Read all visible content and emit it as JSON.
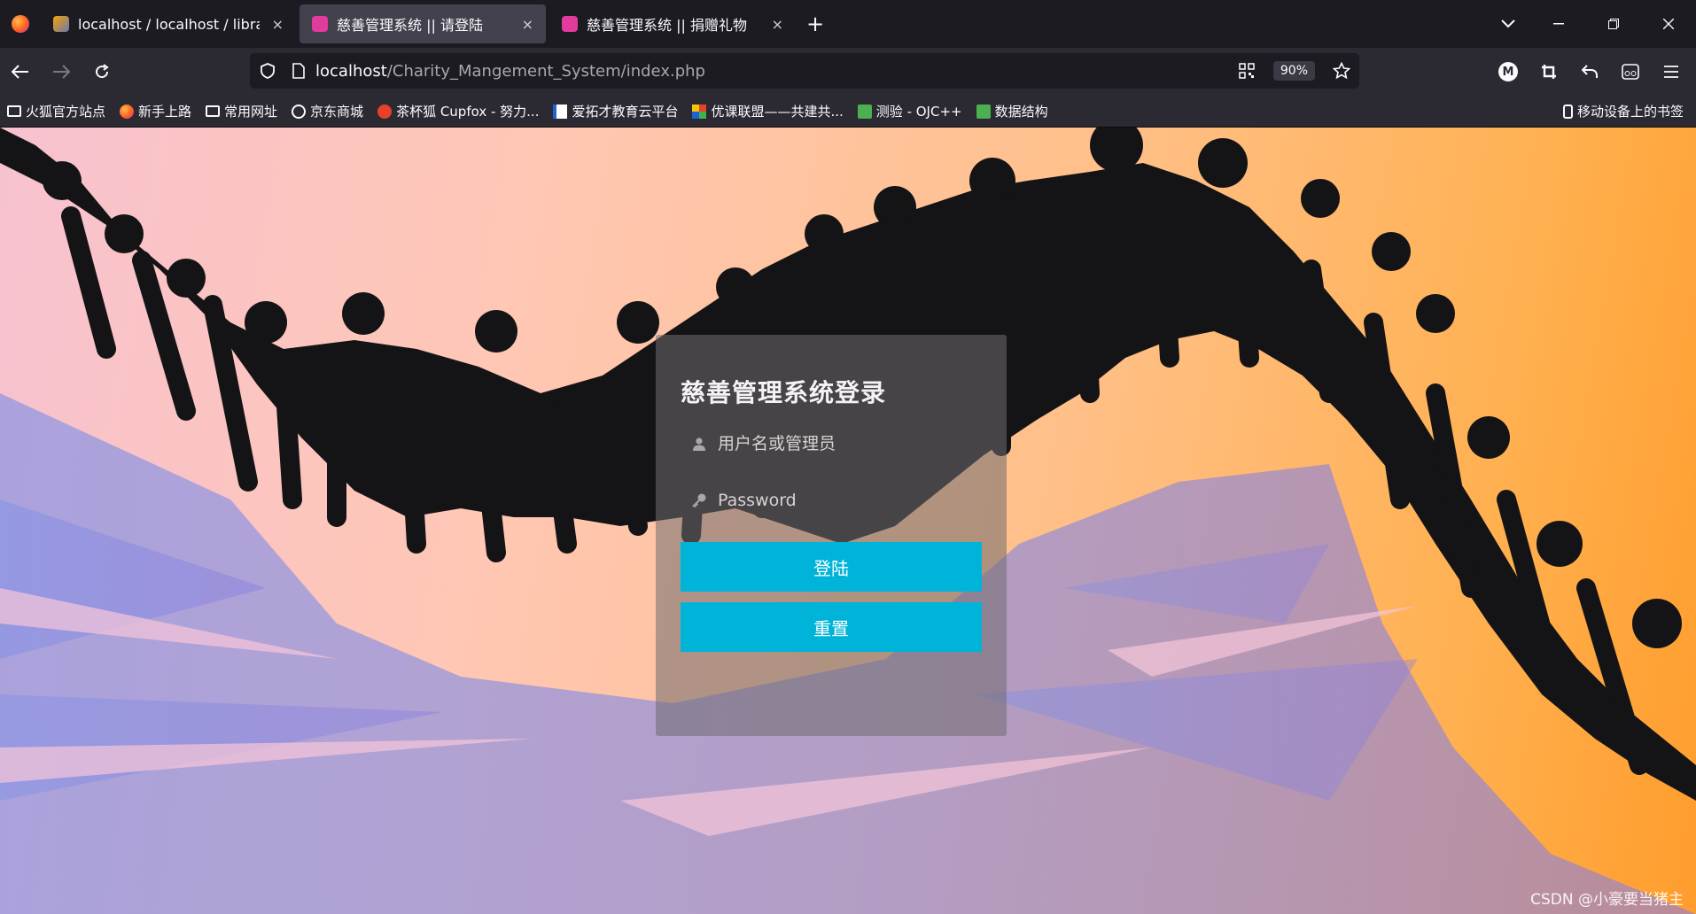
{
  "tabs": [
    {
      "label": "localhost / localhost / library",
      "icon": "phpmyadmin-icon",
      "active": false
    },
    {
      "label": "慈善管理系统 || 请登陆",
      "icon": "site-favicon",
      "active": true
    },
    {
      "label": "慈善管理系统 || 捐赠礼物",
      "icon": "site-favicon",
      "active": false
    }
  ],
  "tab_close": "×",
  "new_tab": "+",
  "url": {
    "host": "localhost",
    "path": "/Charity_Mangement_System/index.php"
  },
  "zoom": "90%",
  "bookmarks": [
    {
      "label": "火狐官方站点",
      "icon": "folder-icon"
    },
    {
      "label": "新手上路",
      "icon": "firefox-icon"
    },
    {
      "label": "常用网址",
      "icon": "folder-icon"
    },
    {
      "label": "京东商城",
      "icon": "globe-icon"
    },
    {
      "label": "茶杯狐 Cupfox - 努力...",
      "icon": "cupfox-icon"
    },
    {
      "label": "爱拓才教育云平台",
      "icon": "edu-icon"
    },
    {
      "label": "优课联盟——共建共...",
      "icon": "uooc-icon"
    },
    {
      "label": "测验 - OJC++",
      "icon": "book-icon"
    },
    {
      "label": "数据结构",
      "icon": "book-icon"
    }
  ],
  "mobile_bookmarks": "移动设备上的书签",
  "login": {
    "title": "慈善管理系统登录",
    "username_placeholder": "用户名或管理员",
    "password_placeholder": "Password",
    "login_button": "登陆",
    "reset_button": "重置"
  },
  "watermark": "CSDN @小豪要当猪主",
  "colors": {
    "accent": "#00b4d9",
    "tab_active": "#42414d",
    "toolbar": "#2b2a33"
  }
}
